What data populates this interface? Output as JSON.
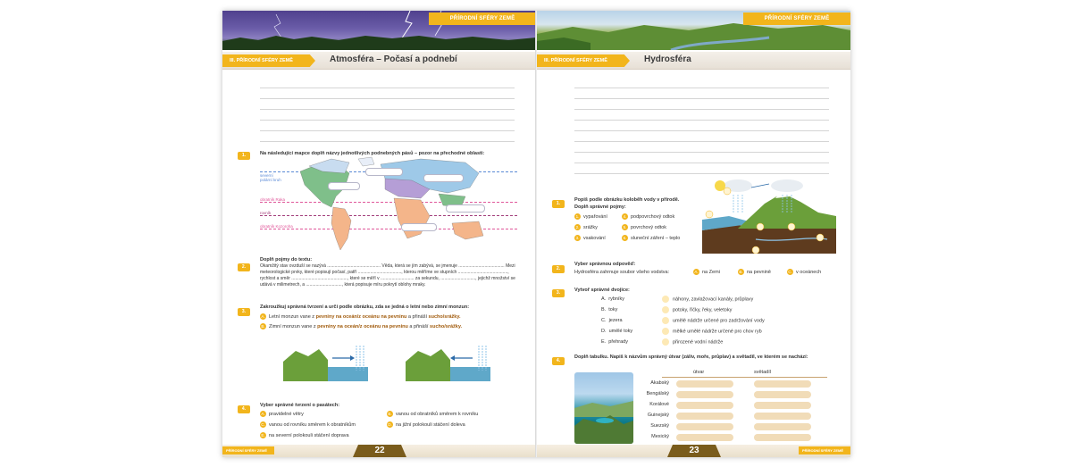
{
  "left": {
    "banner_tag": "PŘÍRODNÍ SFÉRY ZEMĚ",
    "section_tag": "III. PŘÍRODNÍ SFÉRY ZEMĚ",
    "title": "Atmosféra – Počasí a podnebí",
    "task1": {
      "badge": "1.",
      "text": "Na následující mapce doplň názvy jednotlivých podnebných pásů – pozor na přechodné oblasti:",
      "labels": {
        "north_circle": "severní",
        "north_circle2": "polární kruh",
        "tropic_cancer": "obratník Raka",
        "equator": "rovník",
        "tropic_capricorn": "obratník Kozoroha"
      }
    },
    "task2": {
      "badge": "2.",
      "title": "Doplň pojmy do textu:",
      "text": "Okamžitý stav ovzduší se nazývá ........................................... Věda, která se jím zabývá, se jmenuje ..................................... Mezi meteorologické prvky, které popisují počasí, patří ..................................., kterou měříme ve stupních ........................................, rychlost a směr ............................................., které se měří v ........................... za sekundu, ............................, jejichž množství se udává v milimetrech, a ............................., která popisuje míru pokrytí oblohy mraky."
    },
    "task3": {
      "badge": "3.",
      "title": "Zakroužkuj správná tvrzení a urči podle obrázku, zda se jedná o letní nebo zimní monzun:",
      "a_letter": "A.",
      "a_text_pre": "Letní monzun vane z ",
      "a_text_hl": "pevniny na oceán/z oceánu na pevninu",
      "a_text_mid": " a přináší ",
      "a_text_hl2": "sucho/srážky.",
      "b_letter": "B.",
      "b_text_pre": "Zimní monzun vane z ",
      "b_text_hl": "pevniny na oceán/z oceánu na pevninu",
      "b_text_mid": " a přináší ",
      "b_text_hl2": "sucho/srážky."
    },
    "task4": {
      "badge": "4.",
      "title": "Vyber správné tvrzení o pasátech:",
      "options": [
        {
          "letter": "A.",
          "text": "pravidelné větry"
        },
        {
          "letter": "B.",
          "text": "vanou od obratníků směrem k rovníku"
        },
        {
          "letter": "C.",
          "text": "vanou od rovníku směrem k obratníkům"
        },
        {
          "letter": "D.",
          "text": "na jižní polokouli stáčení doleva"
        },
        {
          "letter": "E.",
          "text": "na severní polokouli stáčení doprava"
        }
      ]
    },
    "footer_tag": "PŘÍRODNÍ SFÉRY ZEMĚ",
    "page_number": "22"
  },
  "right": {
    "banner_tag": "PŘÍRODNÍ SFÉRY ZEMĚ",
    "section_tag": "III. PŘÍRODNÍ SFÉRY ZEMĚ",
    "title": "Hydrosféra",
    "task1": {
      "badge": "1.",
      "title": "Popiš podle obrázku koloběh vody v přírodě.",
      "subtitle": "Doplň správné pojmy:",
      "terms": [
        {
          "n": "1.",
          "text": "vypařování"
        },
        {
          "n": "4.",
          "text": "podpovrchový odtok"
        },
        {
          "n": "2.",
          "text": "srážky"
        },
        {
          "n": "5.",
          "text": "povrchový odtok"
        },
        {
          "n": "3.",
          "text": "vsakování"
        },
        {
          "n": "6.",
          "text": "sluneční záření – teplo"
        }
      ]
    },
    "task2": {
      "badge": "2.",
      "title": "Vyber správnou odpověď:",
      "question": "Hydrosféra zahrnuje soubor všeho vodstva:",
      "options": [
        {
          "letter": "A.",
          "text": "na Zemi"
        },
        {
          "letter": "B.",
          "text": "na pevnině"
        },
        {
          "letter": "C.",
          "text": "v oceánech"
        }
      ]
    },
    "task3": {
      "badge": "3.",
      "title": "Vytvoř správné dvojice:",
      "left_items": [
        {
          "letter": "A.",
          "text": "rybníky"
        },
        {
          "letter": "B.",
          "text": "toky"
        },
        {
          "letter": "C.",
          "text": "jezera"
        },
        {
          "letter": "D.",
          "text": "umělé toky"
        },
        {
          "letter": "E.",
          "text": "přehrady"
        }
      ],
      "right_items": [
        "náhony, zavlažovací kanály, průplavy",
        "potoky, říčky, řeky, veletoky",
        "umělé nádrže určené pro zadržování vody",
        "mělké umělé nádrže určené pro chov ryb",
        "přirozené vodní nádrže"
      ]
    },
    "task4": {
      "badge": "4.",
      "title": "Doplň tabulku. Napiš k názvům správný útvar (záliv, moře, průplav) a světadíl, ve kterém se nachází:",
      "col1": "útvar",
      "col2": "světadíl",
      "rows": [
        "Akabský",
        "Bengálský",
        "Korálové",
        "Guinejský",
        "Suezský",
        "Mexický"
      ]
    },
    "footer_tag": "PŘÍRODNÍ SFÉRY ZEMĚ",
    "page_number": "23"
  }
}
